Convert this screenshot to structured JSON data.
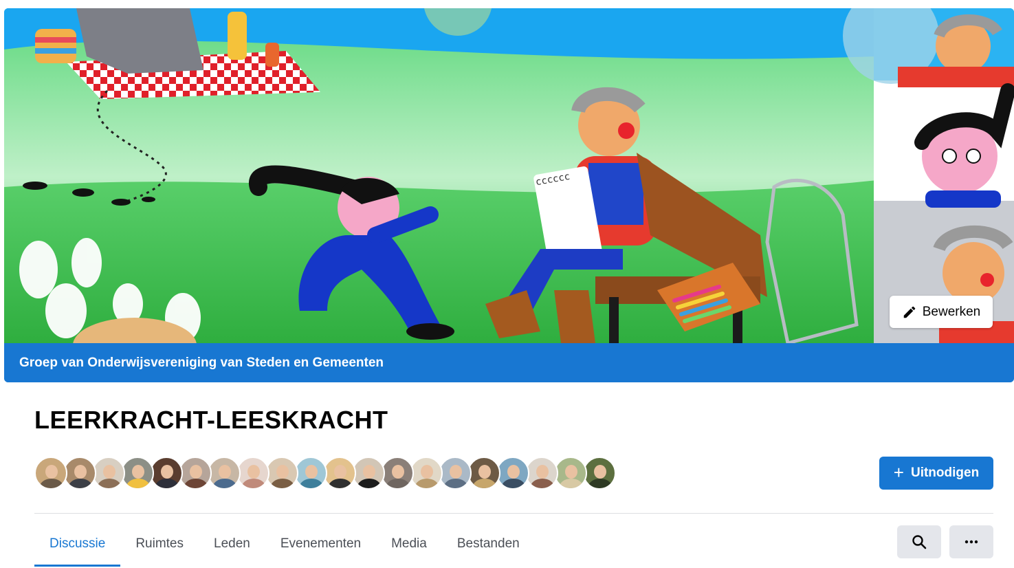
{
  "cover": {
    "group_label": "Groep van Onderwijsvereniging van Steden en Gemeenten",
    "edit_label": "Bewerken",
    "notepad_text": "cccccc"
  },
  "group": {
    "title": "LEERKRACHT-LEESKRACHT",
    "invite_label": "Uitnodigen",
    "invite_icon": "+",
    "members": [
      {
        "bg": "#c9a77a",
        "shirt": "#6b5a48"
      },
      {
        "bg": "#a88a6a",
        "shirt": "#3c3f46"
      },
      {
        "bg": "#d8cfc2",
        "shirt": "#8c6f57"
      },
      {
        "bg": "#8c8f86",
        "shirt": "#f0c040"
      },
      {
        "bg": "#5a3d2f",
        "shirt": "#2d2f3a"
      },
      {
        "bg": "#b6a59a",
        "shirt": "#6d4536"
      },
      {
        "bg": "#c7b7a5",
        "shirt": "#4c6b8e"
      },
      {
        "bg": "#e6d6ce",
        "shirt": "#c08a7a"
      },
      {
        "bg": "#d9c8b2",
        "shirt": "#7a5e44"
      },
      {
        "bg": "#9fc7d6",
        "shirt": "#3e7f9b"
      },
      {
        "bg": "#e3c28d",
        "shirt": "#2f2f2f"
      },
      {
        "bg": "#d2c6b6",
        "shirt": "#1c1c1c"
      },
      {
        "bg": "#8a7f78",
        "shirt": "#6f6660"
      },
      {
        "bg": "#e1d8c7",
        "shirt": "#b89a6c"
      },
      {
        "bg": "#aab9c7",
        "shirt": "#5d6f84"
      },
      {
        "bg": "#6d5a45",
        "shirt": "#c7a66b"
      },
      {
        "bg": "#7ea7c2",
        "shirt": "#3a4e63"
      },
      {
        "bg": "#dcd5cc",
        "shirt": "#8a5f4d"
      },
      {
        "bg": "#a8b88a",
        "shirt": "#d8c9a4"
      },
      {
        "bg": "#5c6f3f",
        "shirt": "#2e3a24"
      }
    ]
  },
  "tabs": [
    {
      "label": "Discussie",
      "active": true
    },
    {
      "label": "Ruimtes",
      "active": false
    },
    {
      "label": "Leden",
      "active": false
    },
    {
      "label": "Evenementen",
      "active": false
    },
    {
      "label": "Media",
      "active": false
    },
    {
      "label": "Bestanden",
      "active": false
    }
  ],
  "icons": {
    "edit": "pencil-icon",
    "invite": "plus-icon",
    "search": "search-icon",
    "more": "more-horizontal-icon"
  },
  "colors": {
    "accent": "#1877d2",
    "cover_sky": "#1aa6f0",
    "cover_grass": "#4fd06a",
    "button_gray": "#e4e6eb"
  }
}
